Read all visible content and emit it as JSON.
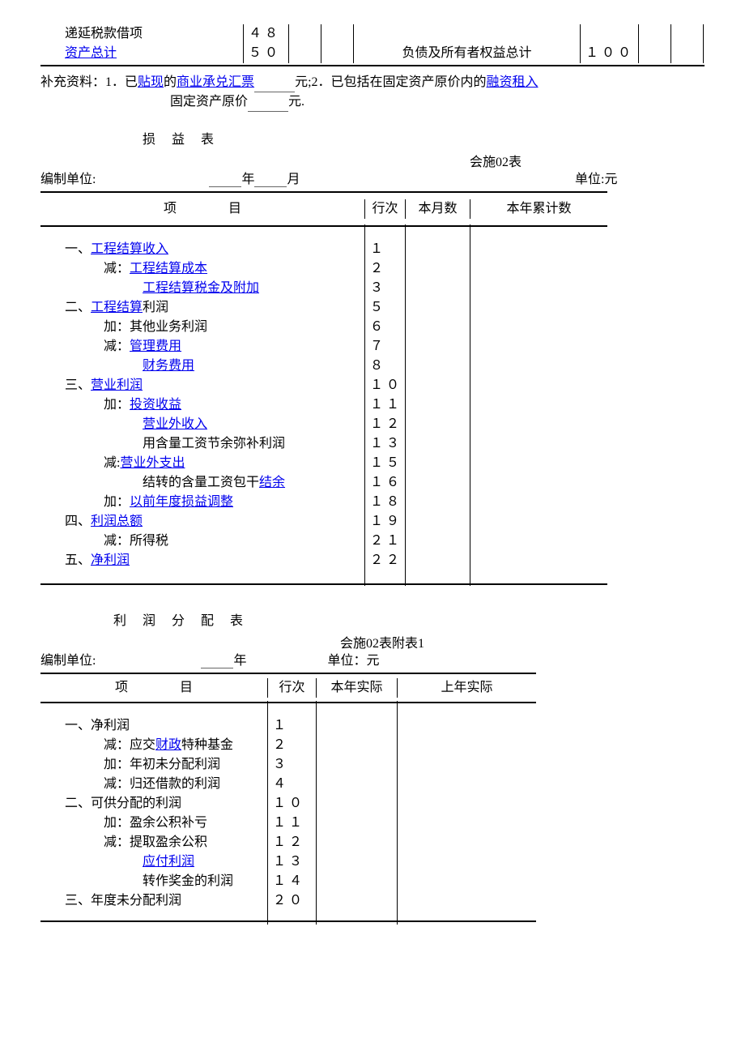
{
  "topRows": [
    {
      "label": "递延税款借项",
      "isLink": false,
      "n1": "４８",
      "right": "",
      "n2": ""
    },
    {
      "label": "资产总计",
      "isLink": true,
      "n1": "５０",
      "right": "负债及所有者权益总计",
      "n2": "１００"
    }
  ],
  "supp": {
    "prefix": "补充资料：1．已",
    "link1": "贴现",
    "mid1": "的",
    "link2": "商业承兑汇票",
    "mid2": "元;2．已包括在固定资产原价内的",
    "link3": "融资租入",
    "line2a": "固定资产原价",
    "line2b": "元."
  },
  "t1": {
    "title": "损益表",
    "formNo": "会施02表",
    "prep": "编制单位:",
    "year": "年",
    "month": "月",
    "unit": "单位:元",
    "h1": "项　　　　目",
    "h2": "行次",
    "h3": "本月数",
    "h4": "本年累计数",
    "rows": [
      {
        "pre": "一、",
        "plain": "",
        "link": "工程结算收入",
        "post": "",
        "indent": 0,
        "num": "１"
      },
      {
        "pre": "减：",
        "plain": "",
        "link": "工程结算成本",
        "post": "",
        "indent": 1,
        "num": "２"
      },
      {
        "pre": "",
        "plain": "",
        "link": "工程结算税金及附加",
        "post": "",
        "indent": 2,
        "num": "３"
      },
      {
        "pre": "二、",
        "plain": "",
        "link": "工程结算",
        "post": "利润",
        "indent": 0,
        "num": "５"
      },
      {
        "pre": "加：其他业务利润",
        "plain": "",
        "link": "",
        "post": "",
        "indent": 1,
        "num": "６"
      },
      {
        "pre": "减：",
        "plain": "",
        "link": "管理费用",
        "post": "",
        "indent": 1,
        "num": "７"
      },
      {
        "pre": "",
        "plain": "",
        "link": "财务费用",
        "post": "",
        "indent": 2,
        "num": "８"
      },
      {
        "pre": "三、",
        "plain": "",
        "link": "营业利润",
        "post": "",
        "indent": 0,
        "num": "１０"
      },
      {
        "pre": "加：",
        "plain": "",
        "link": "投资收益",
        "post": "",
        "indent": 1,
        "num": "１１"
      },
      {
        "pre": "",
        "plain": "",
        "link": "营业外收入",
        "post": "",
        "indent": 2,
        "num": "１２"
      },
      {
        "pre": "",
        "plain": "用含量工资节余弥补利润",
        "link": "",
        "post": "",
        "indent": 2,
        "num": "１３"
      },
      {
        "pre": "减:",
        "plain": "",
        "link": "营业外支出",
        "post": "",
        "indent": 1,
        "num": "１５"
      },
      {
        "pre": "",
        "plain": "结转的含量工资包干",
        "link": "结余",
        "post": "",
        "indent": 2,
        "num": "１６"
      },
      {
        "pre": "加：",
        "plain": "",
        "link": "以前年度损益调整",
        "post": "",
        "indent": 1,
        "num": "１８"
      },
      {
        "pre": "四、",
        "plain": "",
        "link": "利润总额",
        "post": "",
        "indent": 0,
        "num": "１９"
      },
      {
        "pre": "减：所得税",
        "plain": "",
        "link": "",
        "post": "",
        "indent": 1,
        "num": "２１"
      },
      {
        "pre": "五、",
        "plain": "",
        "link": "净利润",
        "post": "",
        "indent": 0,
        "num": "２２"
      }
    ]
  },
  "t2": {
    "title": "利润分配表",
    "formNo": "会施02表附表1",
    "prep": "编制单位:",
    "year": "年",
    "unit": "单位：元",
    "h1": "项　　　　目",
    "h2": "行次",
    "h3": "本年实际",
    "h4": "上年实际",
    "rows": [
      {
        "pre": "一、净利润",
        "plain": "",
        "link": "",
        "post": "",
        "indent": 0,
        "num": "１"
      },
      {
        "pre": "减：应交",
        "plain": "",
        "link": "财政",
        "post": "特种基金",
        "indent": 1,
        "num": "２"
      },
      {
        "pre": "加：年初未分配利润",
        "plain": "",
        "link": "",
        "post": "",
        "indent": 1,
        "num": "３"
      },
      {
        "pre": "减：归还借款的利润",
        "plain": "",
        "link": "",
        "post": "",
        "indent": 1,
        "num": "４"
      },
      {
        "pre": "二、可供分配的利润",
        "plain": "",
        "link": "",
        "post": "",
        "indent": 0,
        "num": "１０"
      },
      {
        "pre": "加：盈余公积补亏",
        "plain": "",
        "link": "",
        "post": "",
        "indent": 1,
        "num": "１１"
      },
      {
        "pre": "减：提取盈余公积",
        "plain": "",
        "link": "",
        "post": "",
        "indent": 1,
        "num": "１２"
      },
      {
        "pre": "",
        "plain": "",
        "link": "应付利润",
        "post": "",
        "indent": 2,
        "num": "１３"
      },
      {
        "pre": "",
        "plain": "转作奖金的利润",
        "link": "",
        "post": "",
        "indent": 2,
        "num": "１４"
      },
      {
        "pre": "三、年度未分配利润",
        "plain": "",
        "link": "",
        "post": "",
        "indent": 0,
        "num": "２０"
      }
    ]
  }
}
